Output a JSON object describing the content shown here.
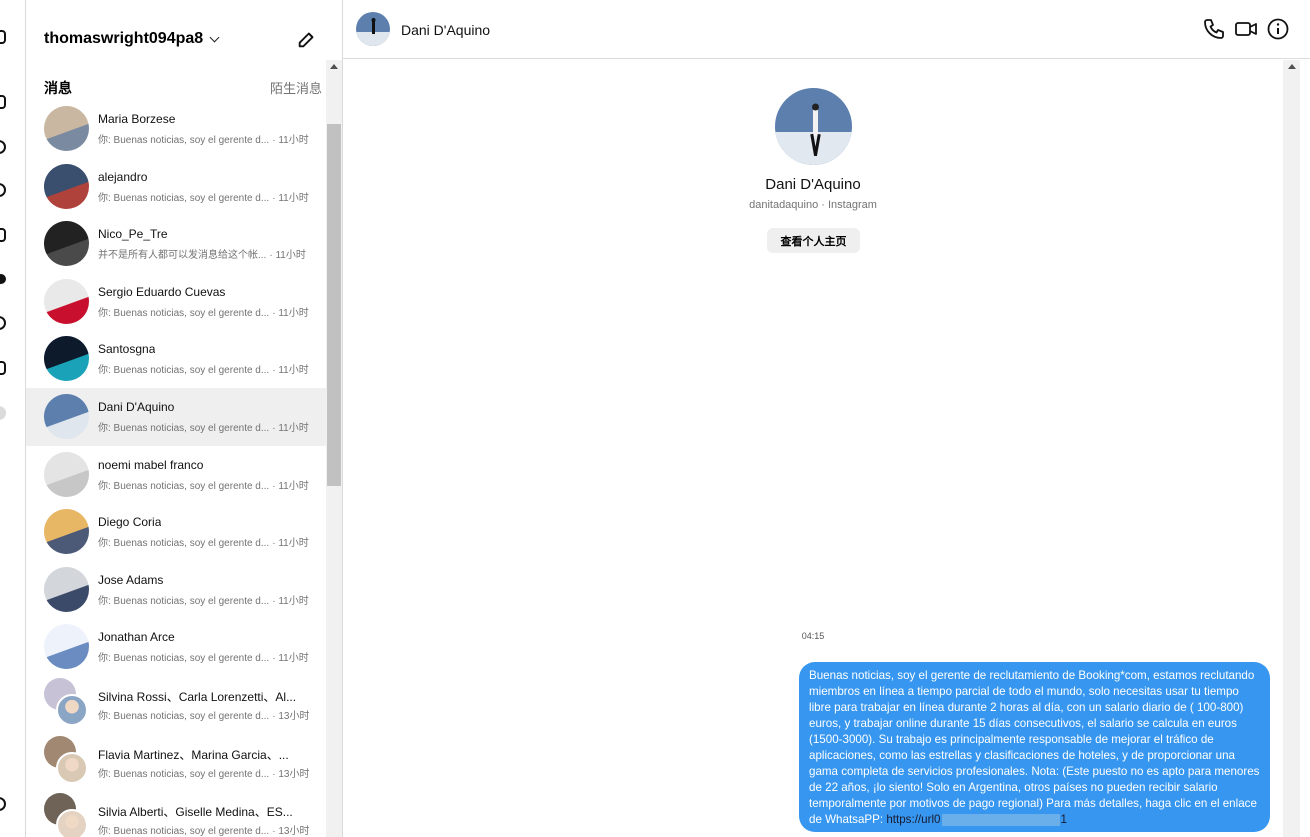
{
  "account": {
    "username": "thomaswright094pa8"
  },
  "sidebar": {
    "section_title": "消息",
    "requests_label": "陌生消息"
  },
  "threads": [
    {
      "name": "Maria Borzese",
      "preview": "你: Buenas noticias, soy el gerente d...",
      "time": "· 11小时",
      "avatar_colors": [
        "#c9b7a2",
        "#7a8aa0"
      ]
    },
    {
      "name": "alejandro",
      "preview": "你: Buenas noticias, soy el gerente d...",
      "time": "· 11小时",
      "avatar_colors": [
        "#3a4e6e",
        "#b0423c"
      ]
    },
    {
      "name": "Nico_Pe_Tre",
      "preview": "并不是所有人都可以发消息给这个帐...",
      "time": "· 11小时",
      "avatar_colors": [
        "#222222",
        "#4a4a4a"
      ]
    },
    {
      "name": "Sergio Eduardo Cuevas",
      "preview": "你: Buenas noticias, soy el gerente d...",
      "time": "· 11小时",
      "avatar_colors": [
        "#e9e9e9",
        "#c8102e"
      ]
    },
    {
      "name": "Santosgna",
      "preview": "你: Buenas noticias, soy el gerente d...",
      "time": "· 11小时",
      "avatar_colors": [
        "#0d1a2b",
        "#1aa3b8"
      ]
    },
    {
      "name": "Dani D'Aquino",
      "preview": "你: Buenas noticias, soy el gerente d...",
      "time": "· 11小时",
      "avatar_colors": [
        "#5c7fae",
        "#dfe6ee"
      ],
      "active": true
    },
    {
      "name": "noemi mabel franco",
      "preview": "你: Buenas noticias, soy el gerente d...",
      "time": "· 11小时",
      "avatar_colors": [
        "#e4e4e4",
        "#c7c7c7"
      ]
    },
    {
      "name": "Diego Coria",
      "preview": "你: Buenas noticias, soy el gerente d...",
      "time": "· 11小时",
      "avatar_colors": [
        "#e8b766",
        "#4c5a78"
      ]
    },
    {
      "name": "Jose Adams",
      "preview": "你: Buenas noticias, soy el gerente d...",
      "time": "· 11小时",
      "avatar_colors": [
        "#d3d7db",
        "#3b4a68"
      ]
    },
    {
      "name": "Jonathan Arce",
      "preview": "你: Buenas noticias, soy el gerente d...",
      "time": "· 11小时",
      "avatar_colors": [
        "#eef3fb",
        "#6a8cc0"
      ]
    },
    {
      "name": "Silvina Rossi、Carla Lorenzetti、Al...",
      "preview": "你: Buenas noticias, soy el gerente d...",
      "time": "· 13小时",
      "avatar_colors": [
        "#c7c2d6",
        "#8aa6c4"
      ],
      "group": true
    },
    {
      "name": "Flavia Martinez、Marina Garcia、...",
      "preview": "你: Buenas noticias, soy el gerente d...",
      "time": "· 13小时",
      "avatar_colors": [
        "#a08872",
        "#d8c8b4"
      ],
      "group": true
    },
    {
      "name": "Silvia Alberti、Giselle Medina、ES...",
      "preview": "你: Buenas noticias, soy el gerente d...",
      "time": "· 13小时",
      "avatar_colors": [
        "#6f6257",
        "#e4d2c2"
      ],
      "group": true
    }
  ],
  "chat": {
    "name": "Dani D'Aquino",
    "handle": "danitadaquino · Instagram",
    "profile_button": "查看个人主页",
    "timestamp": "04:15",
    "message": "Buenas noticias, soy el gerente de reclutamiento de Booking*com, estamos reclutando miembros en línea a tiempo parcial de todo el mundo, solo necesitas usar tu tiempo libre para trabajar en línea durante 2 horas al día, con un salario diario de ( 100-800) euros, y trabajar online durante 15 días consecutivos, el salario se calcula en euros (1500-3000). Su trabajo es principalmente responsable de mejorar el tráfico de aplicaciones, como las estrellas y clasificaciones de hoteles, y de proporcionar una gama completa de servicios profesionales. Nota: (Este puesto no es apto para menores de 22 años, ¡lo siento! Solo en Argentina, otros países no pueden recibir salario temporalmente por motivos de pago regional) Para más detalles, haga clic en el enlace de WhatsaPP:",
    "link_text": "https://url0",
    "link_suffix": "1",
    "bubble_color": "#3797f0"
  },
  "icons": {
    "header": [
      "phone-icon",
      "video-icon",
      "info-icon"
    ],
    "compose": "compose-icon"
  }
}
